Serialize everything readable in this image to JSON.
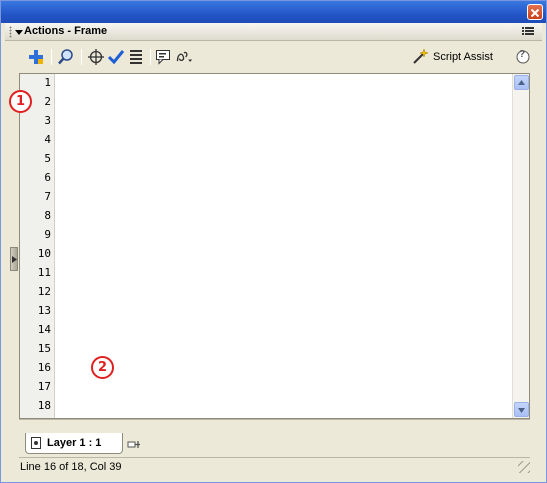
{
  "window": {
    "panel_title": "Actions - Frame"
  },
  "toolbar": {
    "script_assist_label": "Script Assist",
    "help_label": "?"
  },
  "code": {
    "line_numbers": [
      "1",
      "2",
      "3",
      "4",
      "5",
      "6",
      "7",
      "8",
      "9",
      "10",
      "11",
      "12",
      "13",
      "14",
      "15",
      "16",
      "17",
      "18"
    ]
  },
  "layer_tab": {
    "label": "Layer 1 : 1"
  },
  "status": {
    "text": "Line 16 of 18, Col 39"
  },
  "markers": {
    "one": "1",
    "two": "2"
  },
  "colors": {
    "keyword": "#0000ff",
    "string": "#009900",
    "marker": "#e02020",
    "title_bar": "#2456c7"
  }
}
